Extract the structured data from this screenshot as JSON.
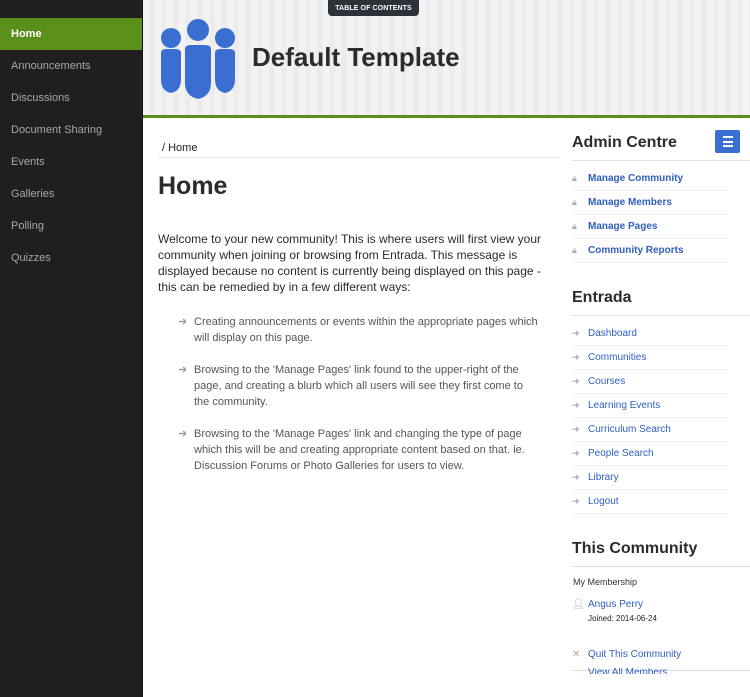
{
  "sidebar": {
    "items": [
      {
        "label": "Home",
        "active": true
      },
      {
        "label": "Announcements"
      },
      {
        "label": "Discussions"
      },
      {
        "label": "Document Sharing"
      },
      {
        "label": "Events"
      },
      {
        "label": "Galleries"
      },
      {
        "label": "Polling"
      },
      {
        "label": "Quizzes"
      }
    ]
  },
  "header": {
    "toc_label": "TABLE OF CONTENTS",
    "title": "Default Template",
    "logo_icon": "community-users-icon"
  },
  "main": {
    "breadcrumb": "/ Home",
    "title": "Home",
    "intro": "Welcome to your new community! This is where users will first view your community when joining or browsing from Entrada. This message is displayed because no content is currently being displayed on this page - this can be remedied by in a few different ways:",
    "bullets": [
      "Creating announcements or events within the appropriate pages which will display on this page.",
      "Browsing to the 'Manage Pages' link found to the upper-right of the page, and creating a blurb which all users will see they first come to the community.",
      "Browsing to the 'Manage Pages' link and changing the type of page which this will be and creating appropriate content based on that. ie. Discussion Forums or Photo Galleries for users to view."
    ]
  },
  "right": {
    "admin": {
      "title": "Admin Centre",
      "links": [
        "Manage Community",
        "Manage Members",
        "Manage Pages",
        "Community Reports"
      ]
    },
    "entrada": {
      "title": "Entrada",
      "links": [
        "Dashboard",
        "Communities",
        "Courses",
        "Learning Events",
        "Curriculum Search",
        "People Search",
        "Library",
        "Logout"
      ]
    },
    "community": {
      "title": "This Community",
      "membership_label": "My Membership",
      "member_name": "Angus Perry",
      "joined": "Joined: 2014-06-24",
      "quit": "Quit This Community",
      "view_all": "View All Members"
    }
  },
  "colors": {
    "accent_green": "#5b8f1c",
    "link_blue": "#2f5fbf",
    "logo_blue": "#3a6fd1",
    "sidebar_bg": "#1f1f1f"
  }
}
